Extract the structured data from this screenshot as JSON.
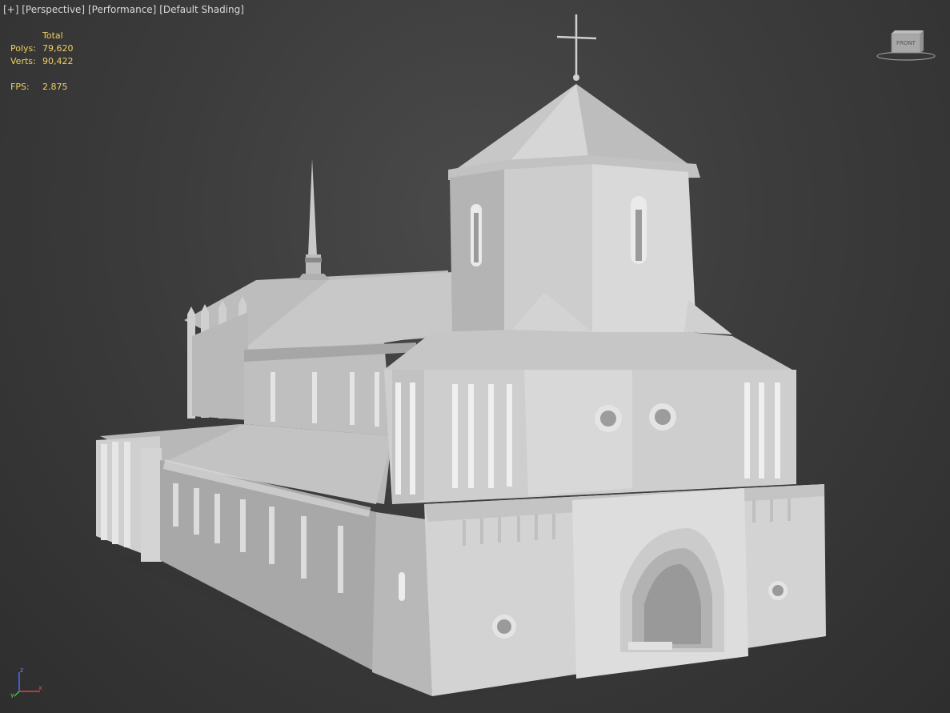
{
  "viewport": {
    "label_parts": [
      "[+]",
      "[Perspective]",
      "[Performance]",
      "[Default Shading]"
    ],
    "stats": {
      "header": "Total",
      "rows": [
        {
          "label": "Polys:",
          "value": "79,620"
        },
        {
          "label": "Verts:",
          "value": "90,422"
        },
        {
          "label": "FPS:",
          "value": "2.875"
        }
      ]
    },
    "viewcube": {
      "face_label": "FRONT"
    },
    "axis": {
      "z": "z",
      "x": "x",
      "y": "y"
    }
  },
  "colors": {
    "stats_text": "#f0d060",
    "label_text": "#d9d9d9",
    "model_light": "#d2d2d2",
    "model_mid": "#b4b4b4",
    "model_dark": "#8f8f8f"
  }
}
